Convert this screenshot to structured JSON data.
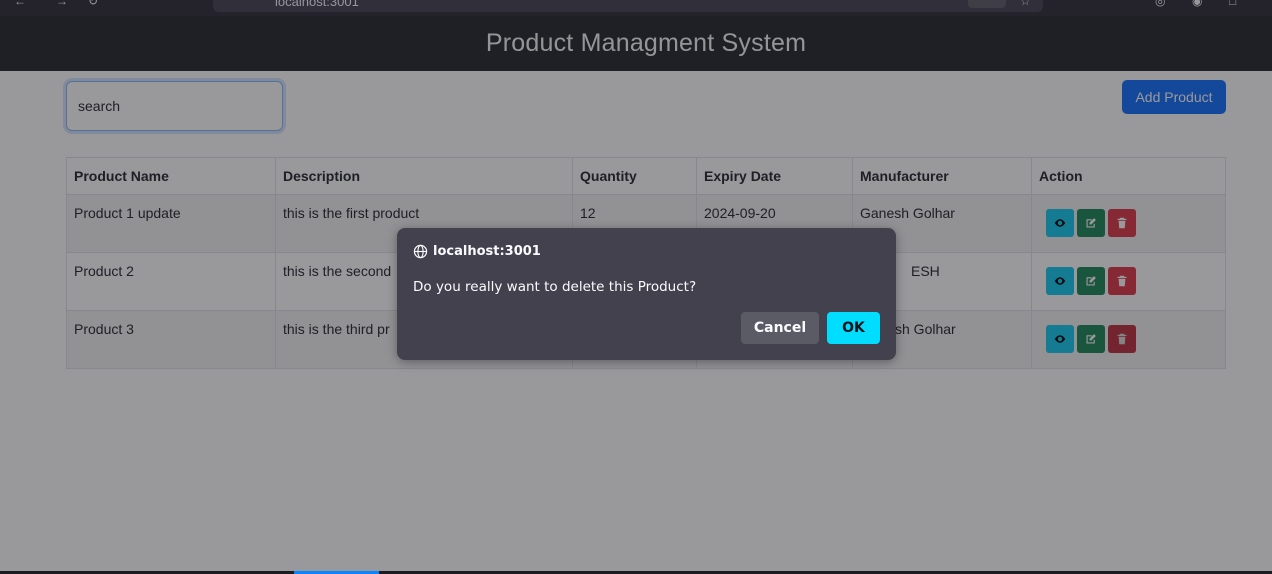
{
  "browser": {
    "url": "localhost:3001",
    "zoom": "90%"
  },
  "header": {
    "title": "Product Managment System"
  },
  "toolbar": {
    "search_placeholder": "search",
    "add_label": "Add Product"
  },
  "table": {
    "headers": [
      "Product Name",
      "Description",
      "Quantity",
      "Expiry Date",
      "Manufacturer",
      "Action"
    ],
    "rows": [
      {
        "name": "Product 1 update",
        "description": "this is the first product",
        "quantity": "12",
        "expiry": "2024-09-20",
        "manufacturer": "Ganesh Golhar"
      },
      {
        "name": "Product 2",
        "description": "this is the second",
        "quantity": "",
        "expiry": "",
        "manufacturer": "ESH"
      },
      {
        "name": "Product 3",
        "description": "this is the third pr",
        "quantity": "",
        "expiry": "",
        "manufacturer": "sh Golhar"
      }
    ]
  },
  "dialog": {
    "origin": "localhost:3001",
    "message": "Do you really want to delete this Product?",
    "cancel_label": "Cancel",
    "ok_label": "OK"
  },
  "colors": {
    "view": "#0dcaf0",
    "edit": "#198754",
    "delete": "#dc3545",
    "primary": "#0d6efd",
    "ok": "#00ddff"
  }
}
